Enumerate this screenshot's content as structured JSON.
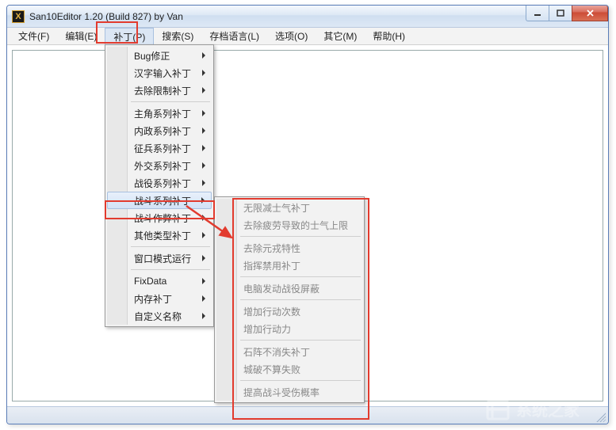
{
  "window": {
    "title": "San10Editor 1.20 (Build 827) by Van",
    "app_icon_letter": "X"
  },
  "menubar": {
    "items": [
      {
        "label": "文件(F)"
      },
      {
        "label": "编辑(E)"
      },
      {
        "label": "补丁(P)"
      },
      {
        "label": "搜索(S)"
      },
      {
        "label": "存档语言(L)"
      },
      {
        "label": "选项(O)"
      },
      {
        "label": "其它(M)"
      },
      {
        "label": "帮助(H)"
      }
    ]
  },
  "patch_menu": {
    "items": [
      {
        "label": "Bug修正",
        "has_sub": true
      },
      {
        "label": "汉字输入补丁",
        "has_sub": true
      },
      {
        "label": "去除限制补丁",
        "has_sub": true
      },
      {
        "sep": true
      },
      {
        "label": "主角系列补丁",
        "has_sub": true
      },
      {
        "label": "内政系列补丁",
        "has_sub": true
      },
      {
        "label": "征兵系列补丁",
        "has_sub": true
      },
      {
        "label": "外交系列补丁",
        "has_sub": true
      },
      {
        "label": "战役系列补丁",
        "has_sub": true
      },
      {
        "label": "战斗系列补丁",
        "has_sub": true,
        "hover": true
      },
      {
        "label": "战斗作弊补丁",
        "has_sub": true
      },
      {
        "label": "其他类型补丁",
        "has_sub": true
      },
      {
        "sep": true
      },
      {
        "label": "窗口模式运行",
        "has_sub": true
      },
      {
        "sep": true
      },
      {
        "label": "FixData",
        "has_sub": true
      },
      {
        "label": "内存补丁",
        "has_sub": true
      },
      {
        "label": "自定义名称",
        "has_sub": true
      }
    ]
  },
  "battle_submenu": {
    "items": [
      {
        "label": "无限减士气补丁"
      },
      {
        "label": "去除疲劳导致的士气上限"
      },
      {
        "sep": true
      },
      {
        "label": "去除元戎特性"
      },
      {
        "label": "指挥禁用补丁"
      },
      {
        "sep": true
      },
      {
        "label": "电脑发动战役屏蔽"
      },
      {
        "sep": true
      },
      {
        "label": "增加行动次数"
      },
      {
        "label": "增加行动力"
      },
      {
        "sep": true
      },
      {
        "label": "石阵不消失补丁"
      },
      {
        "label": "城破不算失败"
      },
      {
        "sep": true
      },
      {
        "label": "提高战斗受伤概率"
      }
    ]
  },
  "watermark_text": "系统之家"
}
